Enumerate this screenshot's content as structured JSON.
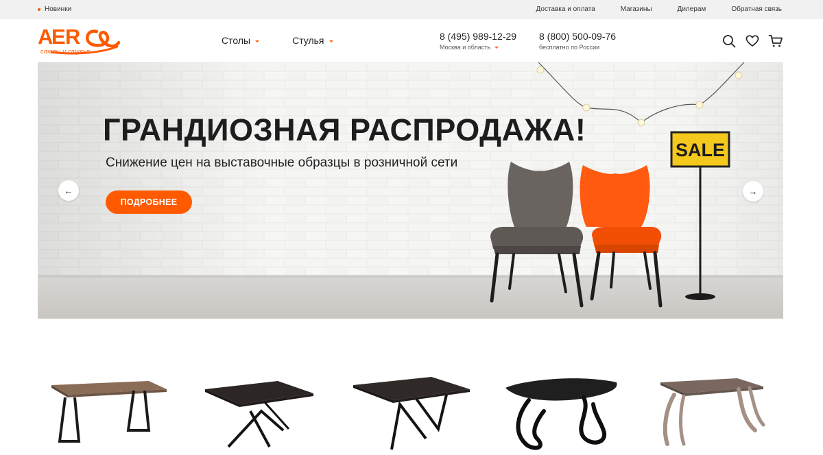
{
  "topbar": {
    "news_label": "Новинки",
    "links": [
      "Доставка и оплата",
      "Магазины",
      "Дилерам",
      "Обратная связь"
    ]
  },
  "logo": {
    "brand": "AERO",
    "tagline": "столы и стулья"
  },
  "nav": {
    "items": [
      "Столы",
      "Стулья"
    ]
  },
  "phones": [
    {
      "number": "8 (495) 989-12-29",
      "note": "Москва и область"
    },
    {
      "number": "8 (800) 500-09-76",
      "note": "бесплатно по России"
    }
  ],
  "icons": [
    "search-icon",
    "heart-icon",
    "cart-icon"
  ],
  "hero": {
    "title": "ГРАНДИОЗНАЯ РАСПРОДАЖА!",
    "subtitle": "Снижение цен на выставочные образцы в розничной сети",
    "cta_label": "ПОДРОБНЕЕ",
    "sign_text": "SALE",
    "prev_arrow": "←",
    "next_arrow": "→"
  },
  "products": [
    "wooden-table-trapezoid-legs",
    "dark-table-x-legs",
    "dark-table-cross-legs",
    "black-oval-table-curved-legs",
    "brown-table-curved-legs"
  ],
  "colors": {
    "accent": "#ff5a00",
    "topbar_bg": "#f1f1f1",
    "chair_grey": "#6a6461",
    "chair_orange": "#ff5a10",
    "sign_yellow": "#f4c81c"
  }
}
